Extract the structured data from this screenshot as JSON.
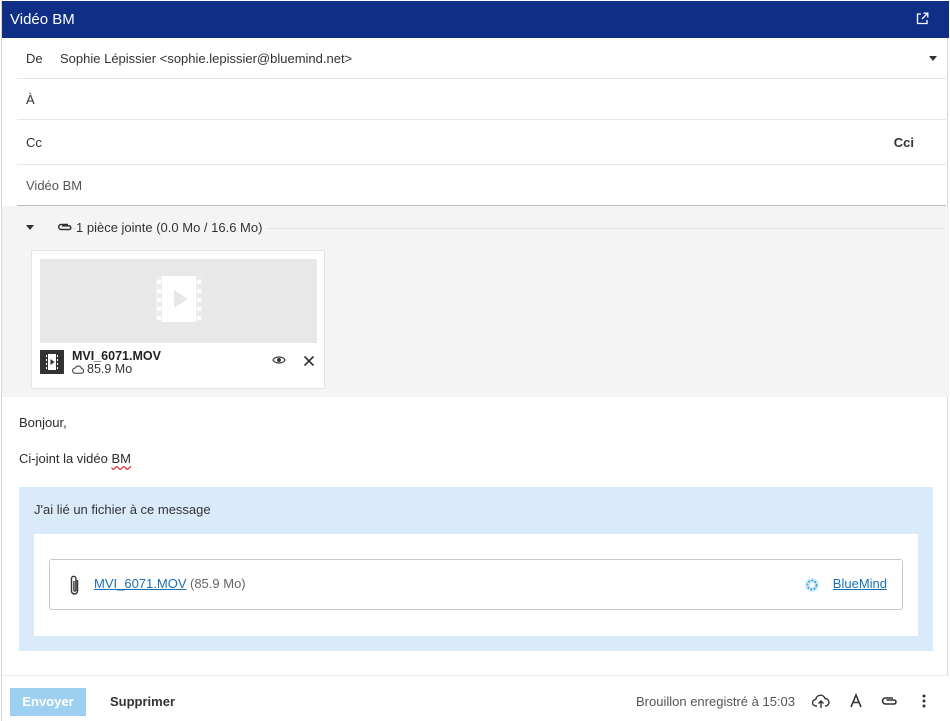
{
  "window": {
    "title": "Vidéo BM"
  },
  "header": {
    "from_label": "De",
    "from_value": "Sophie Lépissier <sophie.lepissier@bluemind.net>",
    "to_label": "À",
    "cc_label": "Cc",
    "cci_label": "Cci",
    "subject": "Vidéo BM"
  },
  "attachments": {
    "summary": "1 pièce jointe (0.0 Mo / 16.6 Mo)",
    "items": [
      {
        "name": "MVI_6071.MOV",
        "size": "85.9 Mo"
      }
    ]
  },
  "body": {
    "greeting": "Bonjour,",
    "line_before": "Ci-joint la vidéo ",
    "line_misspelled": "BM",
    "link_intro": "J'ai lié un fichier à ce message",
    "link_file": "MVI_6071.MOV ",
    "link_size": "(85.9 Mo)",
    "provider": "BlueMind"
  },
  "footer": {
    "send_label": "Envoyer",
    "delete_label": "Supprimer",
    "draft_status": "Brouillon enregistré à 15:03"
  },
  "colors": {
    "titlebar": "#0e2f85",
    "accent_link": "#1a6fb5",
    "send_disabled": "#9dd0f0",
    "link_panel": "#d9ebfb"
  }
}
